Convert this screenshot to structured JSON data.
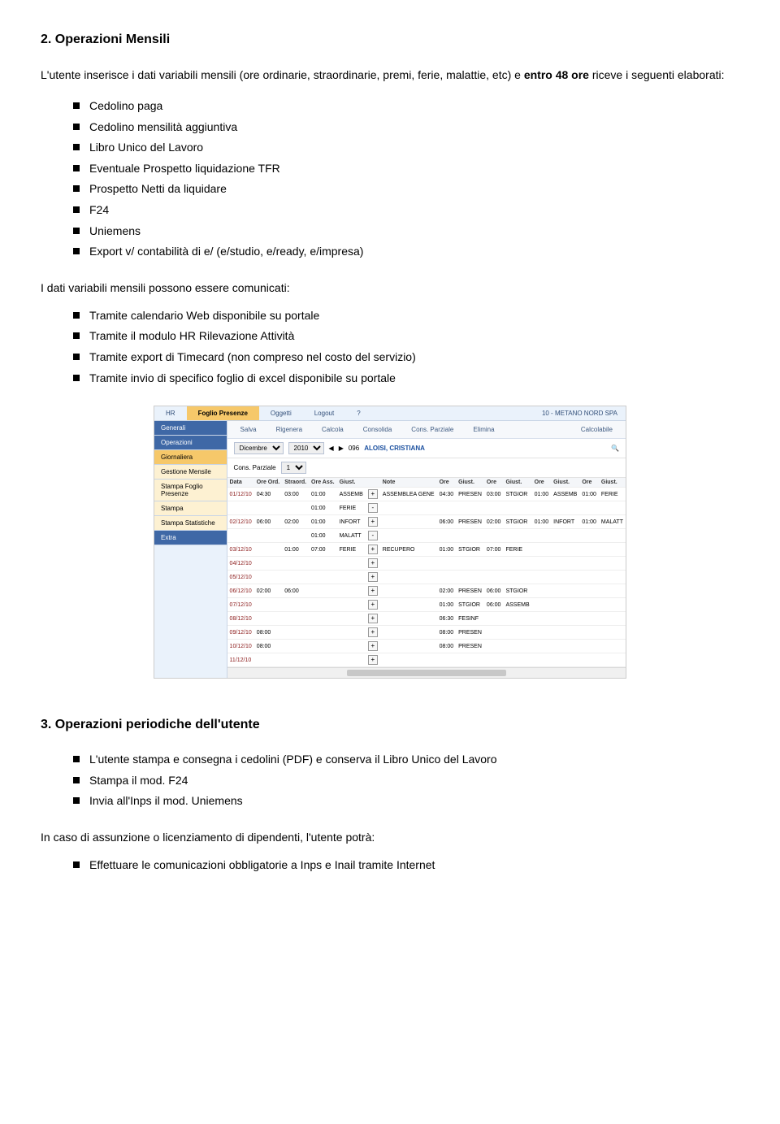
{
  "s2": {
    "heading": "2. Operazioni Mensili",
    "intro_pre": "L'utente inserisce i dati variabili mensili (ore ordinarie, straordinarie, premi, ferie, malattie, etc) e ",
    "intro_bold": "entro 48 ore",
    "intro_post": " riceve i seguenti elaborati:",
    "outputs": [
      "Cedolino paga",
      "Cedolino mensilità aggiuntiva",
      "Libro Unico del Lavoro",
      "Eventuale Prospetto liquidazione TFR",
      "Prospetto Netti da liquidare",
      "F24",
      "Uniemens",
      "Export v/ contabilità di e/ (e/studio, e/ready, e/impresa)"
    ],
    "sub": "I dati variabili mensili possono essere comunicati:",
    "methods": [
      "Tramite calendario Web disponibile su portale",
      "Tramite il modulo HR Rilevazione Attività",
      "Tramite export di Timecard (non compreso nel costo del servizio)",
      "Tramite invio di specifico foglio di excel disponibile su portale"
    ]
  },
  "shot": {
    "tabs": [
      "HR",
      "Foglio Presenze",
      "Oggetti",
      "Logout"
    ],
    "help_icon": "?",
    "company": "10 - METANO NORD SPA",
    "sidebar": {
      "generali": "Generali",
      "operazioni": "Operazioni",
      "giornaliera": "Giornaliera",
      "gestione": "Gestione Mensile",
      "stampa_foglio": "Stampa Foglio Presenze",
      "stampa": "Stampa",
      "stampa_stat": "Stampa Statistiche",
      "extra": "Extra"
    },
    "toolbar": {
      "salva": "Salva",
      "rigenera": "Rigenera",
      "calcola": "Calcola",
      "consolida": "Consolida",
      "cons_parziale": "Cons. Parziale",
      "elimina": "Elimina",
      "calcolabile": "Calcolabile"
    },
    "filter": {
      "month": "Dicembre",
      "year": "2010",
      "code": "096",
      "employee": "ALOISI, CRISTIANA",
      "cons_parziale_label": "Cons. Parziale",
      "cons_parziale_val": "1"
    },
    "grid": {
      "headers": [
        "Data",
        "Ore Ord.",
        "Straord.",
        "Ore Ass.",
        "Giust.",
        "",
        "Note",
        "Ore",
        "Giust.",
        "Ore",
        "Giust.",
        "Ore",
        "Giust.",
        "Ore",
        "Giust."
      ],
      "rows": [
        {
          "date": "01/12/10",
          "c": [
            "04:30",
            "03:00",
            "01:00",
            "ASSEMB",
            "+",
            "ASSEMBLEA GENE",
            "04:30",
            "PRESEN",
            "03:00",
            "STGIOR",
            "01:00",
            "ASSEMB",
            "01:00",
            "FERIE"
          ]
        },
        {
          "date": "",
          "c": [
            "",
            "",
            "01:00",
            "FERIE",
            "-",
            "",
            "",
            "",
            "",
            "",
            "",
            "",
            "",
            ""
          ]
        },
        {
          "date": "02/12/10",
          "c": [
            "06:00",
            "02:00",
            "01:00",
            "INFORT",
            "+",
            "",
            "06:00",
            "PRESEN",
            "02:00",
            "STGIOR",
            "01:00",
            "INFORT",
            "01:00",
            "MALATT"
          ]
        },
        {
          "date": "",
          "c": [
            "",
            "",
            "01:00",
            "MALATT",
            "-",
            "",
            "",
            "",
            "",
            "",
            "",
            "",
            "",
            ""
          ]
        },
        {
          "date": "03/12/10",
          "c": [
            "",
            "01:00",
            "07:00",
            "FERIE",
            "+",
            "RECUPERO",
            "01:00",
            "STGIOR",
            "07:00",
            "FERIE",
            "",
            "",
            "",
            ""
          ]
        },
        {
          "date": "04/12/10",
          "c": [
            "",
            "",
            "",
            "",
            "+",
            "",
            "",
            "",
            "",
            "",
            "",
            "",
            "",
            ""
          ]
        },
        {
          "date": "05/12/10",
          "c": [
            "",
            "",
            "",
            "",
            "+",
            "",
            "",
            "",
            "",
            "",
            "",
            "",
            "",
            ""
          ]
        },
        {
          "date": "06/12/10",
          "c": [
            "02:00",
            "06:00",
            "",
            "",
            "+",
            "",
            "02:00",
            "PRESEN",
            "06:00",
            "STGIOR",
            "",
            "",
            "",
            ""
          ]
        },
        {
          "date": "07/12/10",
          "c": [
            "",
            "",
            "",
            "",
            "+",
            "",
            "01:00",
            "STGIOR",
            "06:00",
            "ASSEMB",
            "",
            "",
            "",
            ""
          ]
        },
        {
          "date": "08/12/10",
          "c": [
            "",
            "",
            "",
            "",
            "+",
            "",
            "06:30",
            "FESINF",
            "",
            "",
            "",
            "",
            "",
            ""
          ]
        },
        {
          "date": "09/12/10",
          "c": [
            "08:00",
            "",
            "",
            "",
            "+",
            "",
            "08:00",
            "PRESEN",
            "",
            "",
            "",
            "",
            "",
            ""
          ]
        },
        {
          "date": "10/12/10",
          "c": [
            "08:00",
            "",
            "",
            "",
            "+",
            "",
            "08:00",
            "PRESEN",
            "",
            "",
            "",
            "",
            "",
            ""
          ]
        },
        {
          "date": "11/12/10",
          "c": [
            "",
            "",
            "",
            "",
            "+",
            "",
            "",
            "",
            "",
            "",
            "",
            "",
            "",
            ""
          ]
        }
      ]
    }
  },
  "s3": {
    "heading": "3. Operazioni periodiche dell'utente",
    "items": [
      "L'utente stampa e consegna i cedolini (PDF) e conserva il Libro Unico del Lavoro",
      "Stampa il mod. F24",
      "Invia all'Inps il mod. Uniemens"
    ],
    "sub": "In caso di assunzione o licenziamento di dipendenti, l'utente potrà:",
    "items2": [
      "Effettuare le comunicazioni obbligatorie a Inps e Inail tramite Internet"
    ]
  }
}
